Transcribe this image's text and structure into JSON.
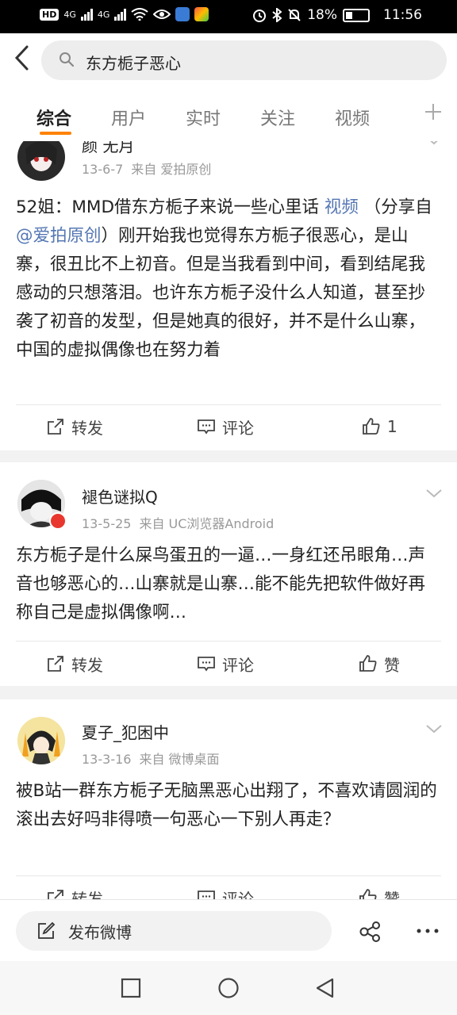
{
  "status_bar": {
    "network1": "4G",
    "network2": "4G",
    "battery": "18%",
    "time": "11:56"
  },
  "search": {
    "query": "东方栀子恶心"
  },
  "tabs": [
    "综合",
    "用户",
    "实时",
    "关注",
    "视频"
  ],
  "posts": [
    {
      "username": "颜 无月",
      "date": "13-6-7",
      "source": "来自 爱拍原创",
      "text_pre": "52姐：MMD借东方栀子来说一些心里话 ",
      "link1": "视频",
      "text_mid": " （分享自 ",
      "link2": "@爱拍原创",
      "text_post": "）刚开始我也觉得东方栀子很恶心，是山寨，很丑比不上初音。但是当我看到中间，看到结尾我感动的只想落泪。也许东方栀子没什么人知道，甚至抄袭了初音的发型，但是她真的很好，并不是什么山寨，中国的虚拟偶像也在努力着",
      "repost": "转发",
      "comment": "评论",
      "like": "1"
    },
    {
      "username": "褪色谜拟Q",
      "date": "13-5-25",
      "source": "来自 UC浏览器Android",
      "text": "东方栀子是什么屎鸟蛋丑的一逼…一身红还吊眼角…声音也够恶心的…山寨就是山寨…能不能先把软件做好再称自己是虚拟偶像啊…",
      "repost": "转发",
      "comment": "评论",
      "like": "赞"
    },
    {
      "username": "夏子_犯困中",
      "date": "13-3-16",
      "source": "来自 微博桌面",
      "text": "被B站一群东方栀子无脑黑恶心出翔了，不喜欢请圆润的滚出去好吗非得喷一句恶心一下别人再走？",
      "repost": "转发",
      "comment": "评论",
      "like": "赞"
    }
  ],
  "composer": {
    "label": "发布微博"
  },
  "colors": {
    "accent": "#ff8200",
    "link": "#5577b3"
  }
}
